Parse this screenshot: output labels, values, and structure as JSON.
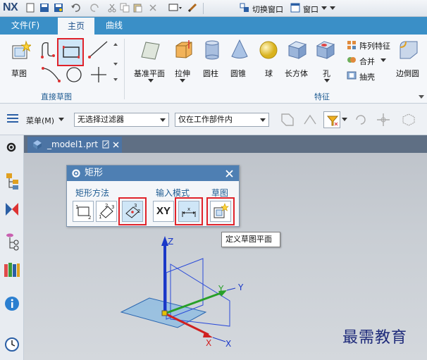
{
  "app": {
    "logo": "NX"
  },
  "quick_toolbar": {
    "switch_window": "切换窗口",
    "window_menu": "窗口"
  },
  "tabs": [
    {
      "label": "文件(F)"
    },
    {
      "label": "主页"
    },
    {
      "label": "曲线"
    }
  ],
  "ribbon": {
    "sketch": "草图",
    "direct_sketch_group": "直接草图",
    "features_group": "特征",
    "datum_plane": "基准平面",
    "extrude": "拉伸",
    "cylinder": "圆柱",
    "cone": "圆锥",
    "sphere": "球",
    "block": "长方体",
    "hole": "孔",
    "pattern_feature": "阵列特征",
    "unite": "合并",
    "shell": "抽壳",
    "edge_blend": "边倒圆"
  },
  "filterbar": {
    "menu": "菜单(M)",
    "type_filter": "无选择过滤器",
    "scope_filter": "仅在工作部件内"
  },
  "document": {
    "tab_label": "_model1.prt"
  },
  "dialog": {
    "title": "矩形",
    "section_method": "矩形方法",
    "section_input": "输入模式",
    "section_sketch": "草图",
    "xy_label": "XY"
  },
  "tooltip": "定义草图平面",
  "axes": {
    "x": "X",
    "y": "Y",
    "z": "Z"
  },
  "watermark": "最需教育",
  "colors": {
    "accent": "#3a8fc7",
    "highlight": "#e0222a",
    "dialog_header": "#4e7fb3"
  }
}
